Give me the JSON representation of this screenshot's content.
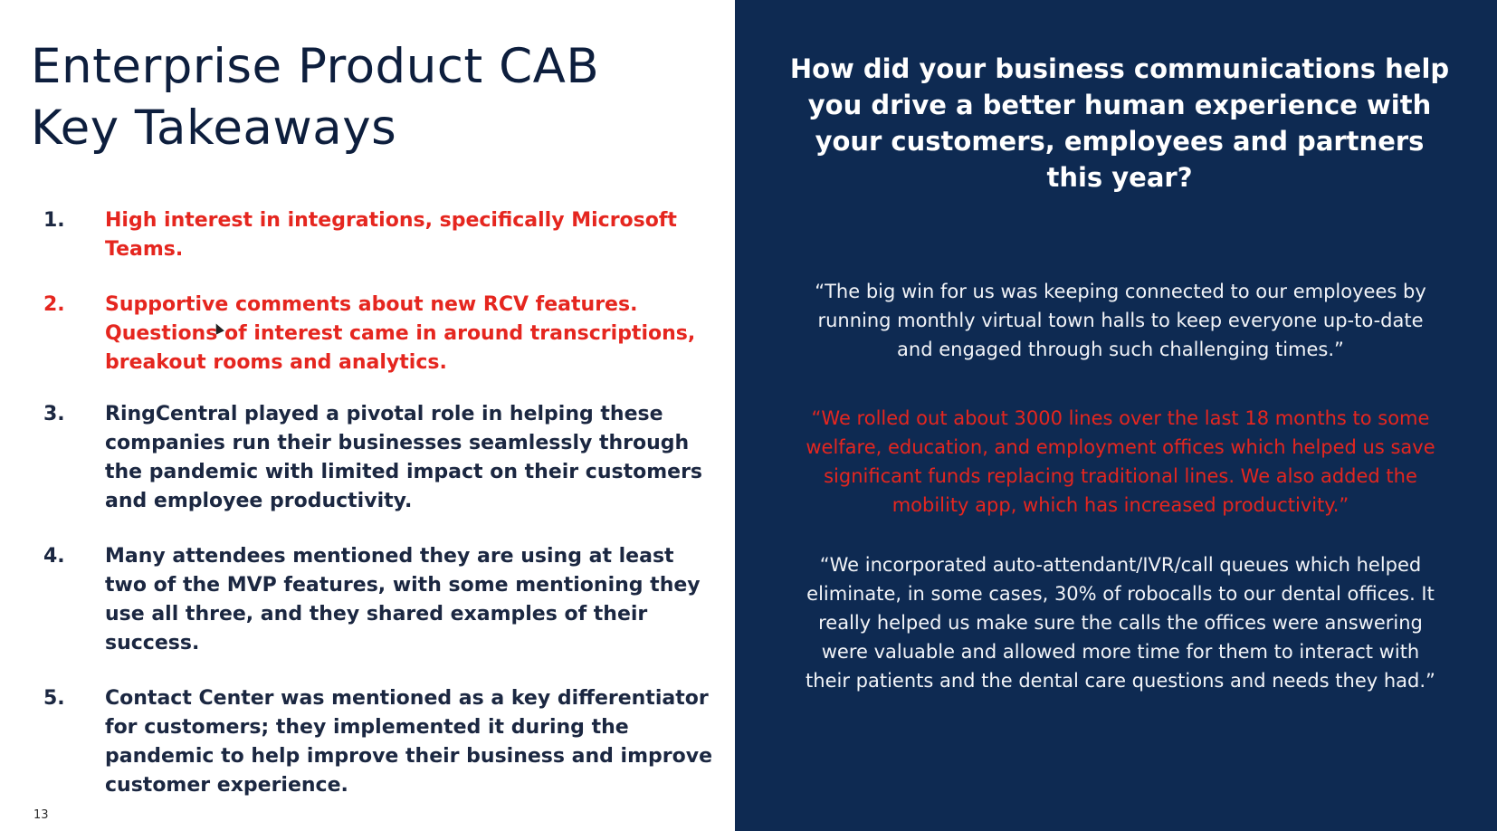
{
  "slide": {
    "title_line1": "Enterprise Product CAB",
    "title_line2": "Key Takeaways",
    "page_number": "13"
  },
  "takeaways": [
    {
      "number": "1.",
      "text": "High interest in integrations, specifically  Microsoft Teams.",
      "highlighted": true
    },
    {
      "number": "2.",
      "text": "Supportive comments about new RCV features. Questions of interest came in around transcriptions, breakout rooms and analytics.",
      "highlighted": true
    },
    {
      "number": "3.",
      "text": "RingCentral played a pivotal role in helping these companies run their businesses seamlessly through the pandemic with limited impact on their customers and employee productivity.",
      "highlighted": false
    },
    {
      "number": "4.",
      "text": "Many attendees mentioned they are using at least two of the MVP features, with some mentioning they use all three, and they shared examples of their success.",
      "highlighted": false
    },
    {
      "number": "5.",
      "text": "Contact Center was mentioned as a key differentiator for customers; they implemented it during the pandemic to help improve their business and  improve customer experience.",
      "highlighted": false
    }
  ],
  "right_panel": {
    "question": "How did your business communications help you drive a better human experience with your customers, employees and partners this year?",
    "quotes": [
      {
        "text": "“The big win for us was keeping connected to our employees by running monthly virtual town halls to keep everyone up-to-date and engaged through such challenging times.”",
        "highlighted": false
      },
      {
        "text": "“We rolled out about 3000 lines over the last 18 months to some welfare, education, and employment offices which helped us save significant funds replacing traditional lines. We also added the mobility app, which has increased productivity.”",
        "highlighted": true
      },
      {
        "text": "“We incorporated auto-attendant/IVR/call queues which helped eliminate, in some cases, 30% of robocalls to our dental offices. It really helped us make sure the calls the offices were answering were valuable and allowed more time for them to interact with their patients and the dental care questions and needs they had.”",
        "highlighted": false
      }
    ]
  },
  "colors": {
    "panel_background": "#0e2a52",
    "highlight_red": "#e5261f",
    "title_text": "#0d1e3d",
    "body_text": "#1b2741"
  },
  "icons": {
    "cursor": "mouse-pointer-icon"
  }
}
